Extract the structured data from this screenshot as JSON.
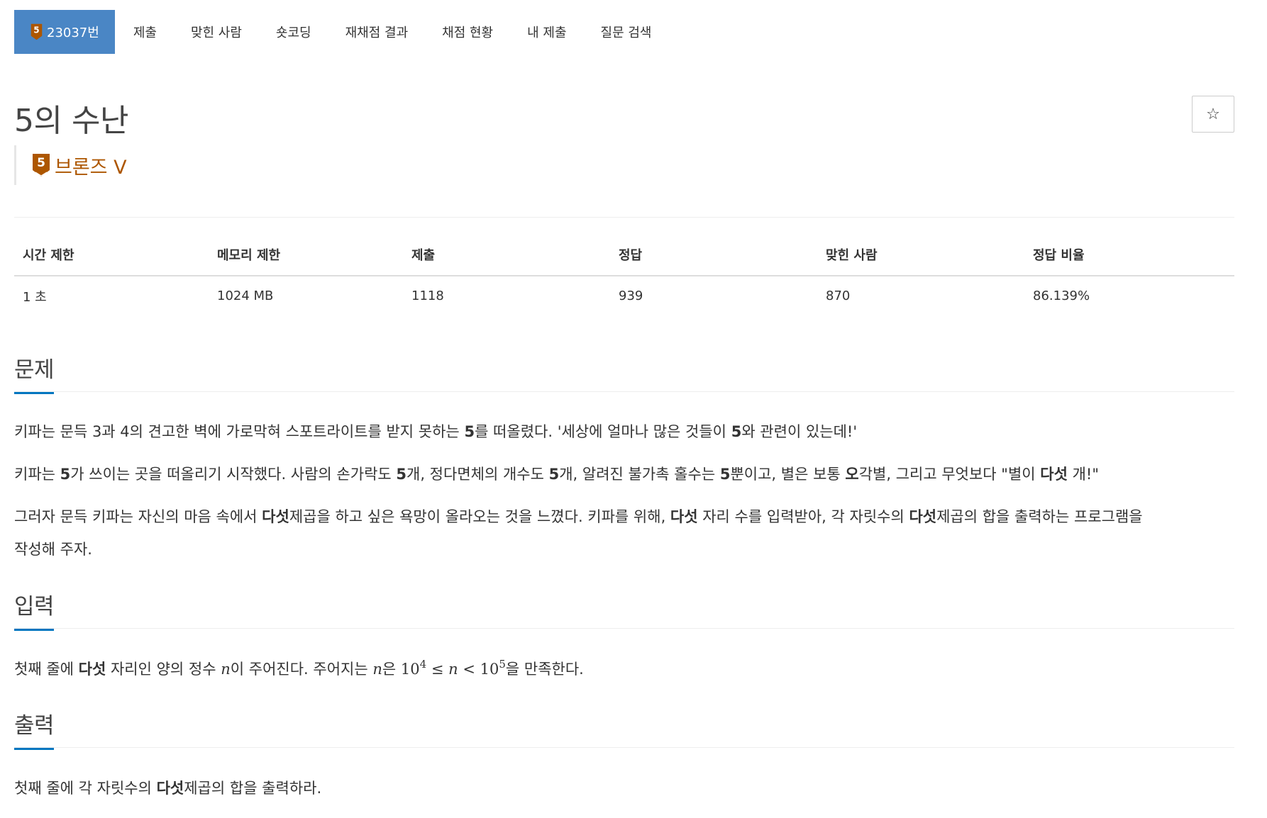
{
  "tabs": {
    "problem_number": "23037번",
    "tier_digit": "5",
    "items": [
      "제출",
      "맞힌 사람",
      "숏코딩",
      "재채점 결과",
      "채점 현황",
      "내 제출",
      "질문 검색"
    ]
  },
  "problem": {
    "title": "5의 수난",
    "star_label": "☆",
    "tier": {
      "digit": "5",
      "name": "브론즈 V",
      "color": "#ad5600"
    }
  },
  "info_table": {
    "headers": [
      "시간 제한",
      "메모리 제한",
      "제출",
      "정답",
      "맞힌 사람",
      "정답 비율"
    ],
    "values": [
      "1 초",
      "1024 MB",
      "1118",
      "939",
      "870",
      "86.139%"
    ]
  },
  "sections": {
    "description": {
      "heading": "문제",
      "p1": {
        "a": "키파는 문득 3과 4의 견고한 벽에 가로막혀 스포트라이트를 받지 못하는 ",
        "b1": "5",
        "c": "를 떠올렸다. '세상에 얼마나 많은 것들이 ",
        "b2": "5",
        "d": "와 관련이 있는데!'"
      },
      "p2": {
        "a": "키파는 ",
        "b1": "5",
        "c": "가 쓰이는 곳을 떠올리기 시작했다. 사람의 손가락도 ",
        "b2": "5",
        "d": "개, 정다면체의 개수도 ",
        "b3": "5",
        "e": "개, 알려진 불가촉 홀수는 ",
        "b4": "5",
        "f": "뿐이고, 별은 보통 ",
        "b5": "오",
        "g": "각별, 그리고 무엇보다 \"별이 ",
        "b6": "다섯",
        "h": " 개!\""
      },
      "p3": {
        "a": "그러자 문득 키파는 자신의 마음 속에서 ",
        "b1": "다섯",
        "c": "제곱을 하고 싶은 욕망이 올라오는 것을 느꼈다. 키파를 위해, ",
        "b2": "다섯",
        "d": " 자리 수를 입력받아, 각 자릿수의 ",
        "b3": "다섯",
        "e": "제곱의 합을 출력하는 프로그램을",
        "f": "작성해 주자."
      }
    },
    "input": {
      "heading": "입력",
      "p": {
        "a": "첫째 줄에 ",
        "b1": "다섯",
        "c": " 자리인 양의 정수 ",
        "var1": "n",
        "d": "이 주어진다. 주어지는 ",
        "var2": "n",
        "e": "은 ",
        "m_base1": "10",
        "m_exp1": "4",
        "m_le": " ≤ ",
        "var3": "n",
        "m_lt": " < ",
        "m_base2": "10",
        "m_exp2": "5",
        "f": "을 만족한다."
      }
    },
    "output": {
      "heading": "출력",
      "p": {
        "a": "첫째 줄에 각 자릿수의 ",
        "b1": "다섯",
        "c": "제곱의 합을 출력하라."
      }
    }
  }
}
